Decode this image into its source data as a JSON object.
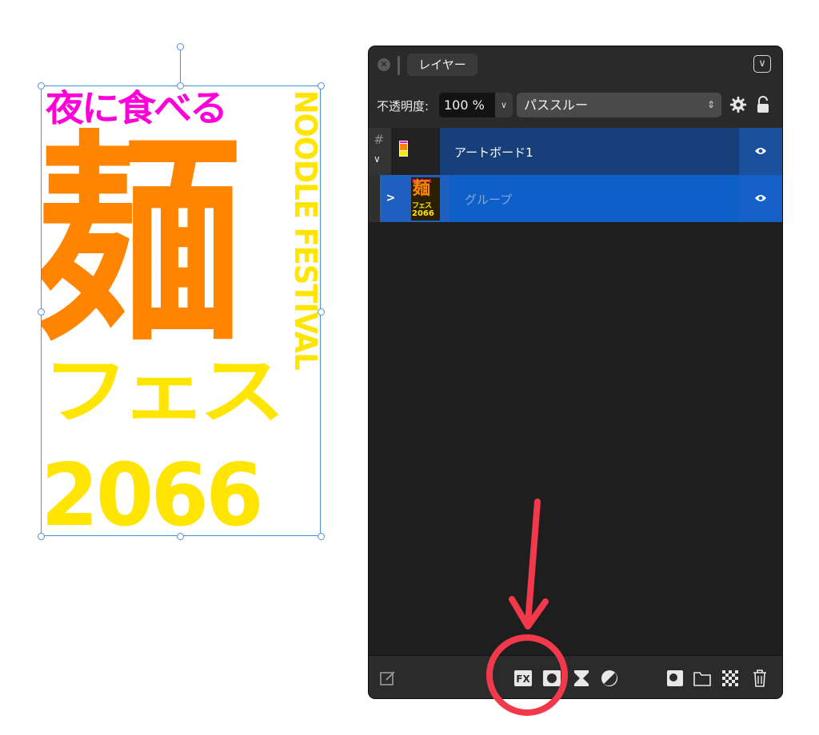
{
  "poster": {
    "line1": "夜に食べる",
    "line2": "麺",
    "line3": "フェス",
    "line4": "2066",
    "vertical": "NOODLE FESTIVAL",
    "colors": {
      "magenta": "#ff00d8",
      "orange": "#ff8400",
      "yellow": "#ffe500"
    }
  },
  "panel": {
    "tab_label": "レイヤー",
    "opacity_label": "不透明度:",
    "opacity_value": "100 %",
    "blend_mode": "パススルー",
    "layers": [
      {
        "name": "アートボード1",
        "type": "artboard",
        "visible": true,
        "icon": "hash-icon"
      },
      {
        "name": "グループ",
        "type": "group",
        "visible": true,
        "expanded": false
      }
    ],
    "thumb_text": {
      "line1": "夜に食べる",
      "line2": "麺",
      "line3": "フェス",
      "line4": "2066"
    },
    "footer_tools": [
      "edit-icon",
      "fx-icon",
      "mask-icon",
      "adjustment-icon",
      "live-filter-icon",
      "add-pixel-layer-icon",
      "add-group-icon",
      "checkerboard-icon",
      "trash-icon"
    ],
    "colors": {
      "selection": "#0f5fc9",
      "accent": "#4a90e2"
    }
  },
  "annotation": {
    "arrow_color": "#f2394b",
    "circle_target": "fx-icon"
  }
}
